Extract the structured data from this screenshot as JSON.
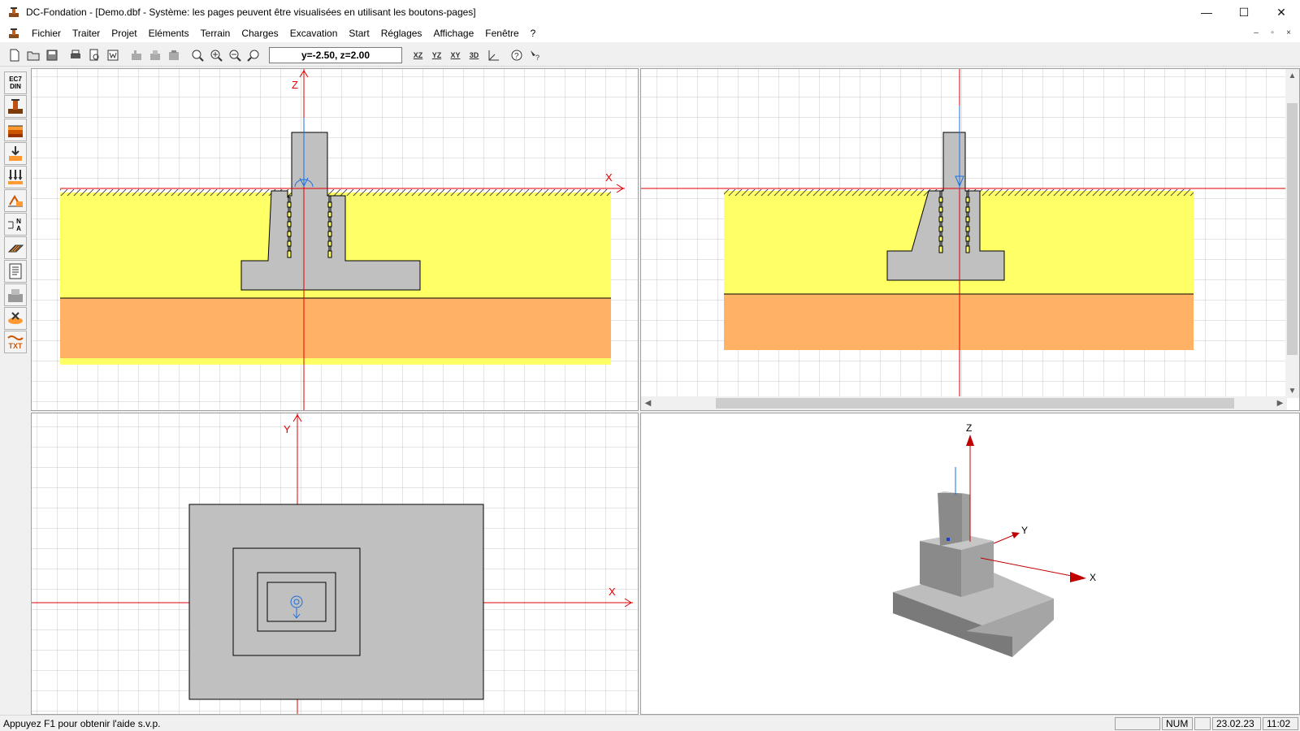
{
  "window": {
    "title": "DC-Fondation - [Demo.dbf - Système: les pages peuvent être visualisées en utilisant les boutons-pages]",
    "controls": [
      "—",
      "☐",
      "✕"
    ]
  },
  "menu": {
    "items": [
      "Fichier",
      "Traiter",
      "Projet",
      "Eléments",
      "Terrain",
      "Charges",
      "Excavation",
      "Start",
      "Réglages",
      "Affichage",
      "Fenêtre",
      "?"
    ],
    "mdi_controls": [
      "–",
      "▫",
      "×"
    ]
  },
  "toolbar": {
    "coordinates": "y=-2.50, z=2.00",
    "view_buttons": [
      "XZ",
      "YZ",
      "XY",
      "3D",
      "3D"
    ],
    "sidebar_labels": {
      "ec7": "EC7",
      "din": "DIN",
      "txt": "TXT",
      "na": "N",
      "na2": "A"
    }
  },
  "views": {
    "front": {
      "axis_h": "X",
      "axis_v": "Z"
    },
    "side": {
      "axis_h": "",
      "axis_v": ""
    },
    "plan": {
      "axis_h": "X",
      "axis_v": "Y"
    },
    "iso": {
      "axis_x": "X",
      "axis_y": "Y",
      "axis_z": "Z"
    }
  },
  "colors": {
    "soil_top": "#ffff66",
    "soil_bottom": "#ffb266",
    "concrete": "#c0c0c0",
    "axis": "#e00000",
    "load": "#1a6fdf",
    "grid": "#c8c8c8"
  },
  "statusbar": {
    "message": "Appuyez F1 pour obtenir l'aide s.v.p.",
    "num": "NUM",
    "date": "23.02.23",
    "time": "11:02"
  }
}
